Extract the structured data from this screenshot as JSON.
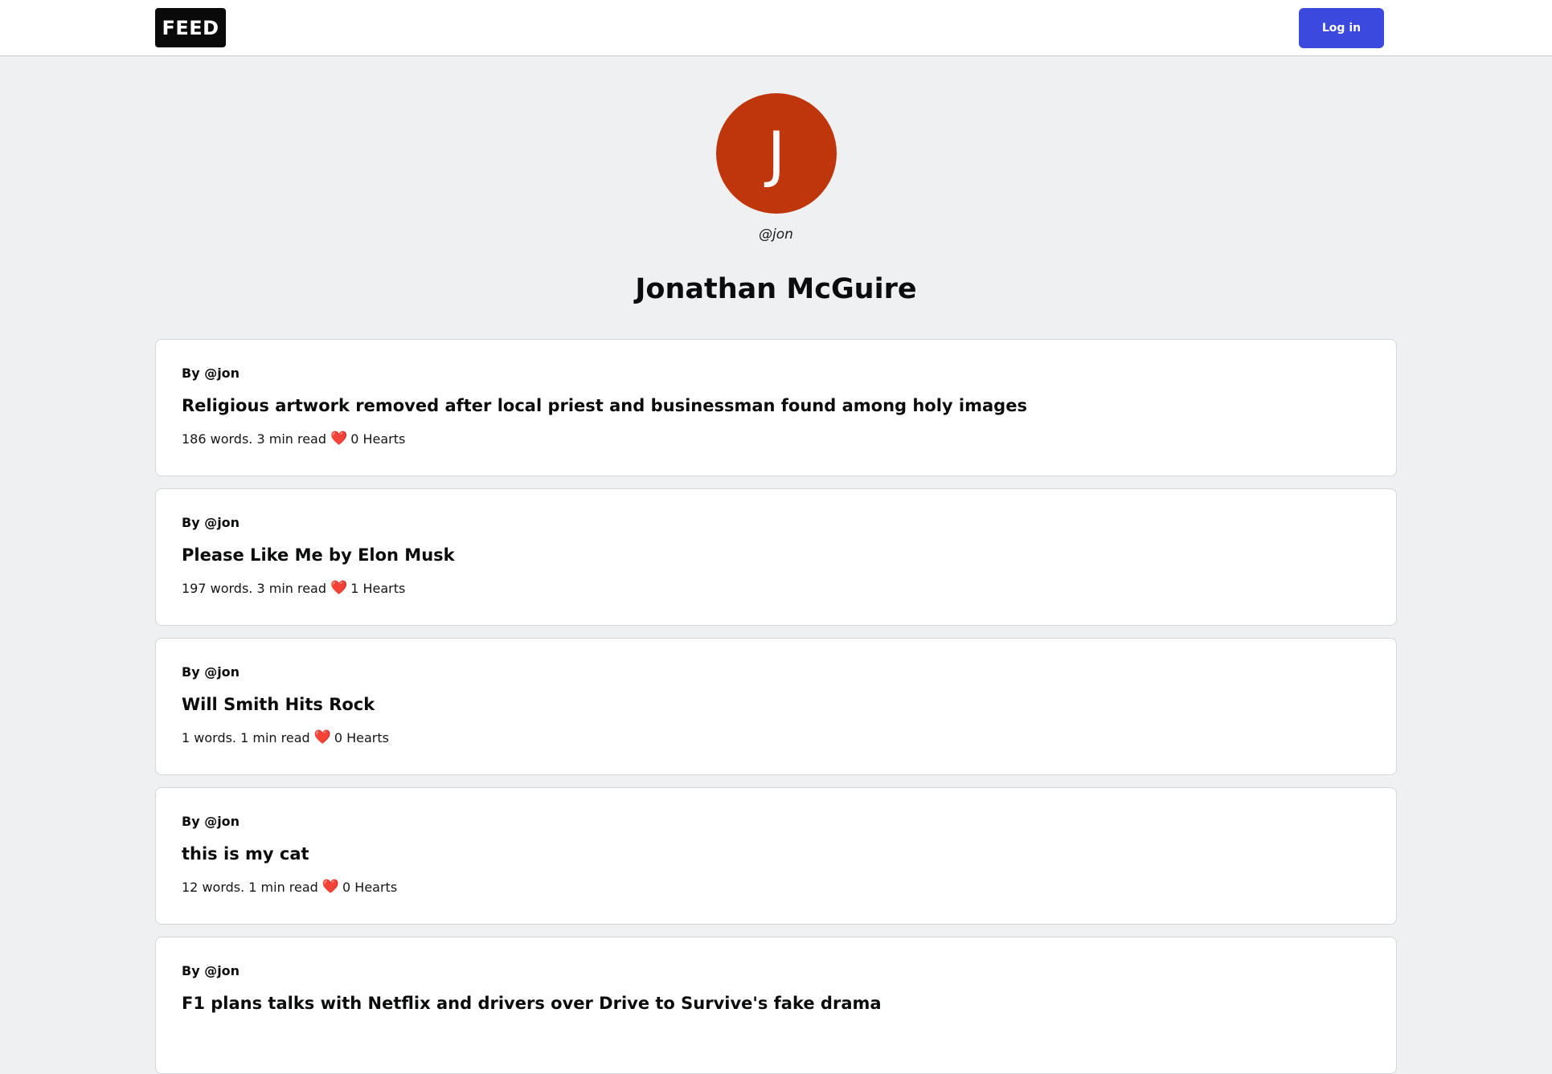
{
  "nav": {
    "logo_text": "FEED",
    "login_label": "Log in"
  },
  "profile": {
    "avatar_initial": "J",
    "avatar_color": "#c0360c",
    "handle": "@jon",
    "name": "Jonathan McGuire"
  },
  "heart_glyph": "❤️",
  "posts": [
    {
      "author": "By @jon",
      "title": "Religious artwork removed after local priest and businessman found among holy images",
      "stats": "186 words. 3 min read",
      "hearts": "0 Hearts"
    },
    {
      "author": "By @jon",
      "title": "Please Like Me by Elon Musk",
      "stats": "197 words. 3 min read",
      "hearts": "1 Hearts"
    },
    {
      "author": "By @jon",
      "title": "Will Smith Hits Rock",
      "stats": "1 words. 1 min read",
      "hearts": "0 Hearts"
    },
    {
      "author": "By @jon",
      "title": "this is my cat",
      "stats": "12 words. 1 min read",
      "hearts": "0 Hearts"
    },
    {
      "author": "By @jon",
      "title": "F1 plans talks with Netflix and drivers over Drive to Survive's fake drama",
      "stats": "",
      "hearts": ""
    }
  ]
}
